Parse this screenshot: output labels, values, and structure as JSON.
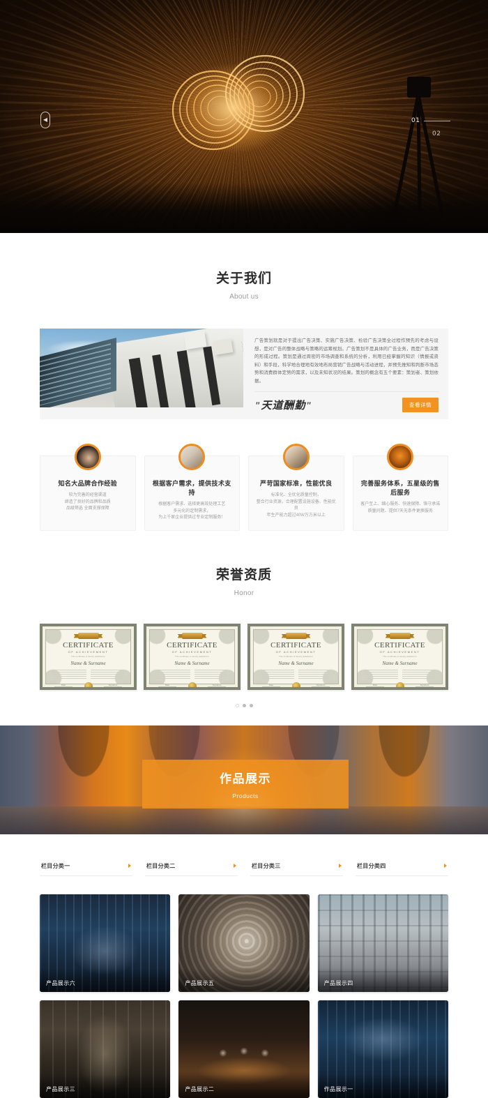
{
  "hero": {
    "prev_icon": "chevron-left-icon",
    "slides": [
      {
        "index": "01",
        "state": "active"
      },
      {
        "index": "02",
        "state": "inactive"
      }
    ]
  },
  "about": {
    "title_cn": "关于我们",
    "title_en": "About us",
    "image_alt": "modern-architecture-photo",
    "description": "广告策划就是对于提出广告决策、实施广告决策、检验广告决策全过程作预先的考虑与设想，是对广告的整体战略与策略的运筹规划。广告策划不是具体的广告业务，而是广告决策的形成过程。策划是通过周密的市场调查和系统的分析，利用已经掌握的知识（情报或资料）和手段，科学地合理地有效地布局营销广告战略与活动进程，并预先推知和判断市场态势和消费群体定势的需求，以及未知状况的结果。策划的概念有五个要素：策划者、策划依据。",
    "slogan": "\"天道酬勤\"",
    "detail_button": "查看详情"
  },
  "features": [
    {
      "icon": "handshake-photo-icon",
      "title": "知名大品牌合作经验",
      "lines": [
        "较为完善的经营渠道",
        "缔造了良好的品牌和品质",
        "品级筛选 全面支撑保障"
      ]
    },
    {
      "icon": "blueprint-photo-icon",
      "title": "根据客户需求，提供技术支持",
      "lines": [
        "根据客户需求、选择更高效处理工艺",
        "多元化的定制需求，",
        "为上千家企业提供过专业定制服务！"
      ]
    },
    {
      "icon": "factory-photo-icon",
      "title": "严苛国家标准，性能优良",
      "lines": [
        "标准化、全优化质量控制，",
        "整合行业资源，合理配置设施设备、性能优良",
        "年生产能力超过40W万方米以上"
      ]
    },
    {
      "icon": "team-photo-icon",
      "title": "完善服务体系，五星级的售后服务",
      "lines": [
        "客户至上、细心服务、快速保障、恪守承诺",
        "质量问题、提供7天无条件更换服务"
      ]
    }
  ],
  "honor": {
    "title_cn": "荣誉资质",
    "title_en": "Honor",
    "certificates": [
      {
        "title": "CERTIFICATE",
        "subtitle": "OF ACHIEVEMENT",
        "micro": "This certificate is hereby awarded to",
        "name": "Name & Surname",
        "left_sig": "Date",
        "right_sig": "Signature"
      },
      {
        "title": "CERTIFICATE",
        "subtitle": "OF ACHIEVEMENT",
        "micro": "This certificate is hereby awarded to",
        "name": "Name & Surname",
        "left_sig": "Date",
        "right_sig": "Signature"
      },
      {
        "title": "CERTIFICATE",
        "subtitle": "OF ACHIEVEMENT",
        "micro": "This certificate is hereby awarded to",
        "name": "Name & Surname",
        "left_sig": "Date",
        "right_sig": "Signature"
      },
      {
        "title": "CERTIFICATE",
        "subtitle": "OF ACHIEVEMENT",
        "micro": "This certificate is hereby awarded to",
        "name": "Name & Surname",
        "left_sig": "Date",
        "right_sig": "Signature"
      }
    ],
    "dots": [
      {
        "state": "off"
      },
      {
        "state": "on"
      },
      {
        "state": "on"
      }
    ]
  },
  "products_banner": {
    "title_cn": "作品展示",
    "title_en": "Products",
    "image_alt": "orange-arched-corridor-photo",
    "overlay_color": "#f09220"
  },
  "category_tabs": [
    {
      "label": "栏目分类一",
      "arrow": "caret-right-icon"
    },
    {
      "label": "栏目分类二",
      "arrow": "caret-right-icon"
    },
    {
      "label": "栏目分类三",
      "arrow": "caret-right-icon"
    },
    {
      "label": "栏目分类四",
      "arrow": "caret-right-icon"
    }
  ],
  "products": [
    {
      "caption": "产品展示六",
      "image_alt": "gothic-hall-interior"
    },
    {
      "caption": "产品展示五",
      "image_alt": "spiral-staircase-dome"
    },
    {
      "caption": "产品展示四",
      "image_alt": "train-station-clock-hall"
    },
    {
      "caption": "产品展示三",
      "image_alt": "long-museum-gallery"
    },
    {
      "caption": "产品展示二",
      "image_alt": "sculpture-busts-gallery"
    },
    {
      "caption": "作品展示一",
      "image_alt": "blue-museum-atrium"
    }
  ],
  "theme": {
    "accent": "#f09220",
    "accent_dark": "#ef8b1f",
    "text_dark": "#2b2b2b",
    "text_muted": "#9a9a9a",
    "panel_bg": "#f5f5f5"
  }
}
